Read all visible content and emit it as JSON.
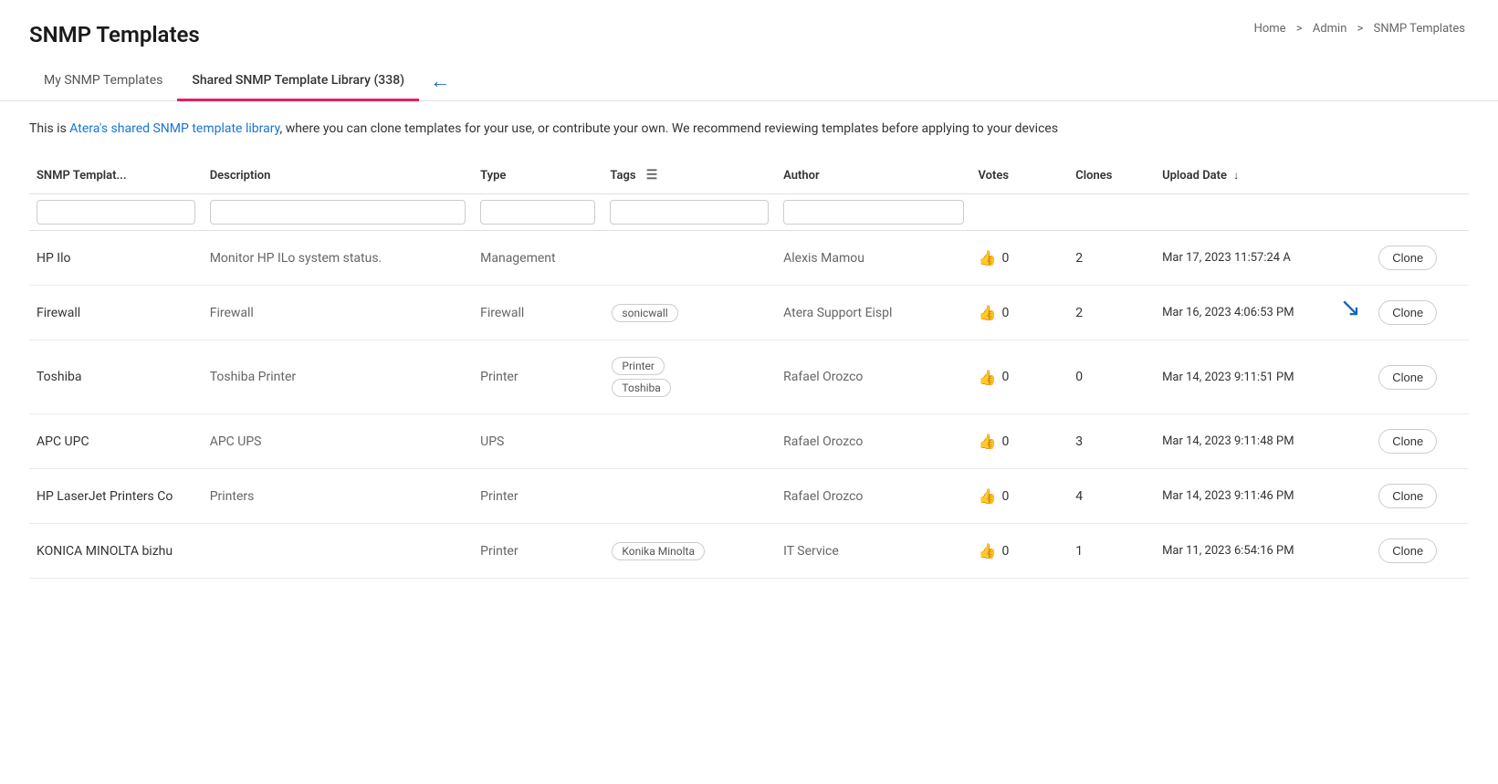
{
  "page": {
    "title": "SNMP Templates",
    "breadcrumb": [
      "Home",
      "Admin",
      "SNMP Templates"
    ]
  },
  "tabs": [
    {
      "id": "my",
      "label": "My SNMP Templates",
      "active": false
    },
    {
      "id": "shared",
      "label": "Shared SNMP Template Library (338)",
      "active": true
    }
  ],
  "description": {
    "prefix": "This is ",
    "link_text": "Atera's shared SNMP template library",
    "suffix": ", where you can clone templates for your use, or contribute your own. We recommend reviewing templates before applying to your devices"
  },
  "table": {
    "columns": [
      {
        "id": "name",
        "label": "SNMP Templat...",
        "filterable": true
      },
      {
        "id": "description",
        "label": "Description",
        "filterable": true
      },
      {
        "id": "type",
        "label": "Type",
        "filterable": true
      },
      {
        "id": "tags",
        "label": "Tags",
        "filterable": true
      },
      {
        "id": "author",
        "label": "Author",
        "filterable": true
      },
      {
        "id": "votes",
        "label": "Votes",
        "filterable": false
      },
      {
        "id": "clones",
        "label": "Clones",
        "filterable": false
      },
      {
        "id": "upload_date",
        "label": "Upload Date",
        "sortable": true,
        "sorted_desc": true,
        "filterable": false
      }
    ],
    "rows": [
      {
        "name": "HP Ilo",
        "description": "Monitor HP ILo system status.",
        "type": "Management",
        "tags": [],
        "author": "Alexis Mamou",
        "votes": 0,
        "clones": 2,
        "upload_date": "Mar 17, 2023 11:57:24 A"
      },
      {
        "name": "Firewall",
        "description": "Firewall",
        "type": "Firewall",
        "tags": [
          "sonicwall"
        ],
        "author": "Atera Support Eispl",
        "votes": 0,
        "clones": 2,
        "upload_date": "Mar 16, 2023 4:06:53 PM"
      },
      {
        "name": "Toshiba",
        "description": "Toshiba Printer",
        "type": "Printer",
        "tags": [
          "Printer",
          "Toshiba"
        ],
        "author": "Rafael Orozco",
        "votes": 0,
        "clones": 0,
        "upload_date": "Mar 14, 2023 9:11:51 PM"
      },
      {
        "name": "APC UPC",
        "description": "APC UPS",
        "type": "UPS",
        "tags": [],
        "author": "Rafael Orozco",
        "votes": 0,
        "clones": 3,
        "upload_date": "Mar 14, 2023 9:11:48 PM"
      },
      {
        "name": "HP LaserJet Printers Co",
        "description": "Printers",
        "type": "Printer",
        "tags": [],
        "author": "Rafael Orozco",
        "votes": 0,
        "clones": 4,
        "upload_date": "Mar 14, 2023 9:11:46 PM"
      },
      {
        "name": "KONICA MINOLTA bizhu",
        "description": "",
        "type": "Printer",
        "tags": [
          "Konika Minolta"
        ],
        "author": "IT Service",
        "votes": 0,
        "clones": 1,
        "upload_date": "Mar 11, 2023 6:54:16 PM"
      }
    ],
    "buttons": {
      "clone": "Clone"
    }
  }
}
